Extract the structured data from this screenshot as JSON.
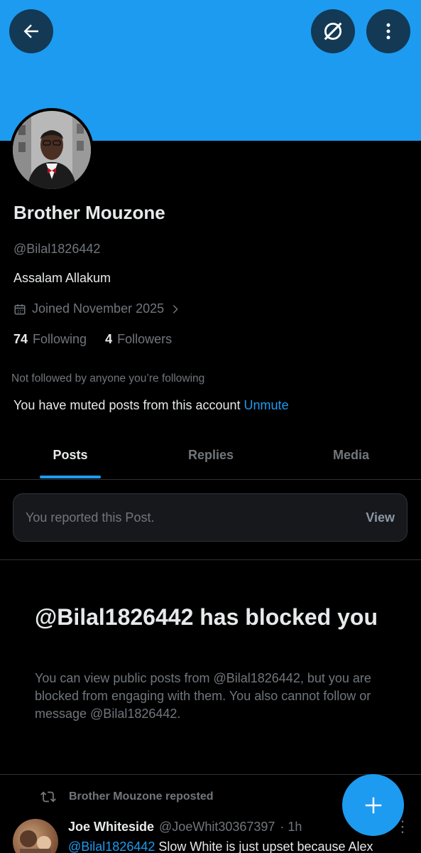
{
  "header": {
    "back_icon": "arrow-left-icon",
    "grok_icon": "grok-icon",
    "more_icon": "more-vertical-icon",
    "banner_color": "#1d9bf0"
  },
  "profile": {
    "name": "Brother Mouzone",
    "handle": "@Bilal1826442",
    "bio": "Assalam Allakum",
    "joined": "Joined November 2025",
    "following_count": "74",
    "following_label": "Following",
    "followers_count": "4",
    "followers_label": "Followers",
    "not_followed": "Not followed by anyone you’re following",
    "muted_text": "You have muted posts from this account",
    "unmute_label": "Unmute"
  },
  "tabs": [
    {
      "label": "Posts",
      "active": true
    },
    {
      "label": "Replies",
      "active": false
    },
    {
      "label": "Media",
      "active": false
    }
  ],
  "report_card": {
    "text": "You reported this Post.",
    "action": "View"
  },
  "blocked": {
    "title": "@Bilal1826442 has blocked you",
    "text": "You can view public posts from @Bilal1826442, but you are blocked from engaging with them. You also cannot follow or message @Bilal1826442."
  },
  "post": {
    "repost_label": "Brother Mouzone reposted",
    "author_name": "Joe Whiteside",
    "author_handle": "@JoeWhit30367397",
    "time": "· 1h",
    "mention": "@Bilal1826442",
    "text": "Slow White is just upset because Alex"
  },
  "fab": {
    "icon": "plus-icon"
  },
  "colors": {
    "accent": "#1d9bf0",
    "background": "#000000",
    "muted_text": "#71767b"
  }
}
